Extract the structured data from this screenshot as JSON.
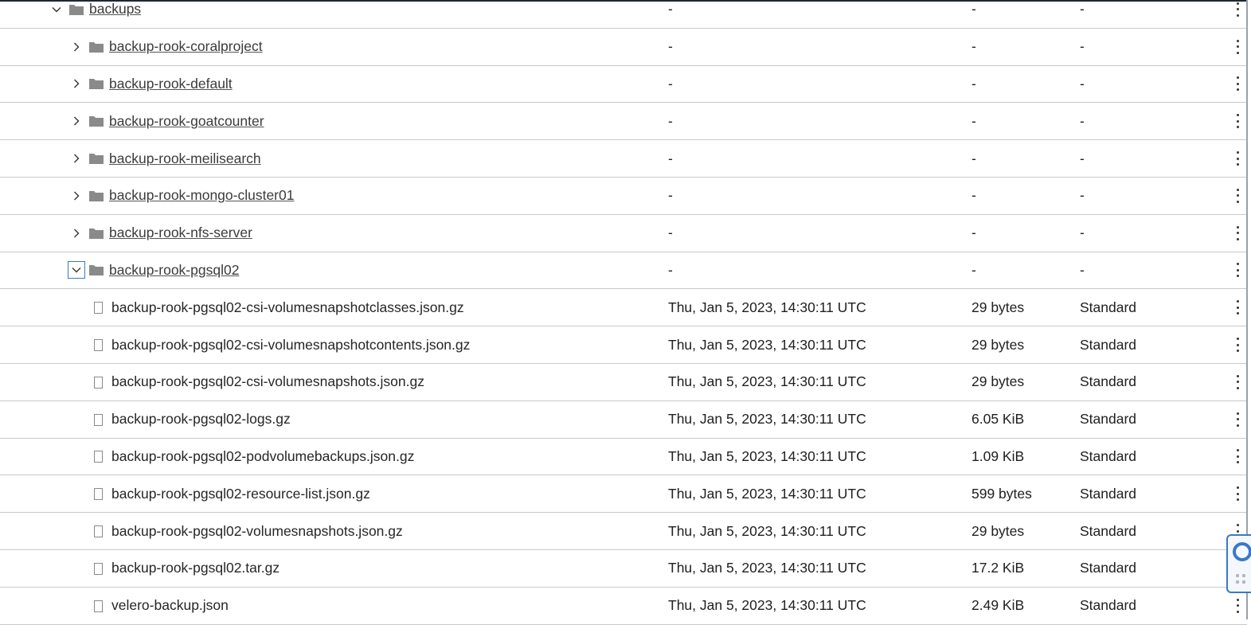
{
  "table": {
    "rows": [
      {
        "kind": "folder",
        "level": 0,
        "expanded": true,
        "name": "backups",
        "last_modified": "-",
        "size": "-",
        "storage_class": "-"
      },
      {
        "kind": "folder",
        "level": 1,
        "expanded": false,
        "name": "backup-rook-coralproject",
        "last_modified": "-",
        "size": "-",
        "storage_class": "-"
      },
      {
        "kind": "folder",
        "level": 1,
        "expanded": false,
        "name": "backup-rook-default",
        "last_modified": "-",
        "size": "-",
        "storage_class": "-"
      },
      {
        "kind": "folder",
        "level": 1,
        "expanded": false,
        "name": "backup-rook-goatcounter",
        "last_modified": "-",
        "size": "-",
        "storage_class": "-"
      },
      {
        "kind": "folder",
        "level": 1,
        "expanded": false,
        "name": "backup-rook-meilisearch",
        "last_modified": "-",
        "size": "-",
        "storage_class": "-"
      },
      {
        "kind": "folder",
        "level": 1,
        "expanded": false,
        "name": "backup-rook-mongo-cluster01",
        "last_modified": "-",
        "size": "-",
        "storage_class": "-"
      },
      {
        "kind": "folder",
        "level": 1,
        "expanded": false,
        "name": "backup-rook-nfs-server",
        "last_modified": "-",
        "size": "-",
        "storage_class": "-"
      },
      {
        "kind": "folder",
        "level": 1,
        "expanded": true,
        "focused": true,
        "name": "backup-rook-pgsql02",
        "last_modified": "-",
        "size": "-",
        "storage_class": "-"
      },
      {
        "kind": "file",
        "level": 2,
        "name": "backup-rook-pgsql02-csi-volumesnapshotclasses.json.gz",
        "last_modified": "Thu, Jan 5, 2023, 14:30:11 UTC",
        "size": "29 bytes",
        "storage_class": "Standard"
      },
      {
        "kind": "file",
        "level": 2,
        "name": "backup-rook-pgsql02-csi-volumesnapshotcontents.json.gz",
        "last_modified": "Thu, Jan 5, 2023, 14:30:11 UTC",
        "size": "29 bytes",
        "storage_class": "Standard"
      },
      {
        "kind": "file",
        "level": 2,
        "name": "backup-rook-pgsql02-csi-volumesnapshots.json.gz",
        "last_modified": "Thu, Jan 5, 2023, 14:30:11 UTC",
        "size": "29 bytes",
        "storage_class": "Standard"
      },
      {
        "kind": "file",
        "level": 2,
        "name": "backup-rook-pgsql02-logs.gz",
        "last_modified": "Thu, Jan 5, 2023, 14:30:11 UTC",
        "size": "6.05 KiB",
        "storage_class": "Standard"
      },
      {
        "kind": "file",
        "level": 2,
        "name": "backup-rook-pgsql02-podvolumebackups.json.gz",
        "last_modified": "Thu, Jan 5, 2023, 14:30:11 UTC",
        "size": "1.09 KiB",
        "storage_class": "Standard"
      },
      {
        "kind": "file",
        "level": 2,
        "name": "backup-rook-pgsql02-resource-list.json.gz",
        "last_modified": "Thu, Jan 5, 2023, 14:30:11 UTC",
        "size": "599 bytes",
        "storage_class": "Standard"
      },
      {
        "kind": "file",
        "level": 2,
        "name": "backup-rook-pgsql02-volumesnapshots.json.gz",
        "last_modified": "Thu, Jan 5, 2023, 14:30:11 UTC",
        "size": "29 bytes",
        "storage_class": "Standard"
      },
      {
        "kind": "file",
        "level": 2,
        "name": "backup-rook-pgsql02.tar.gz",
        "last_modified": "Thu, Jan 5, 2023, 14:30:11 UTC",
        "size": "17.2 KiB",
        "storage_class": "Standard"
      },
      {
        "kind": "file",
        "level": 2,
        "name": "velero-backup.json",
        "last_modified": "Thu, Jan 5, 2023, 14:30:11 UTC",
        "size": "2.49 KiB",
        "storage_class": "Standard"
      }
    ]
  },
  "icons": {
    "folder": "folder-icon",
    "file": "file-icon",
    "expand": "chevron-right-icon",
    "collapse": "chevron-down-icon",
    "row_menu": "more-vert-icon",
    "help": "lifebuoy-icon",
    "drag": "drag-handle-icon"
  },
  "colors": {
    "focus_ring": "#3a78c8",
    "folder": "#8a8a8a",
    "row_divider": "#c9c9c9"
  }
}
